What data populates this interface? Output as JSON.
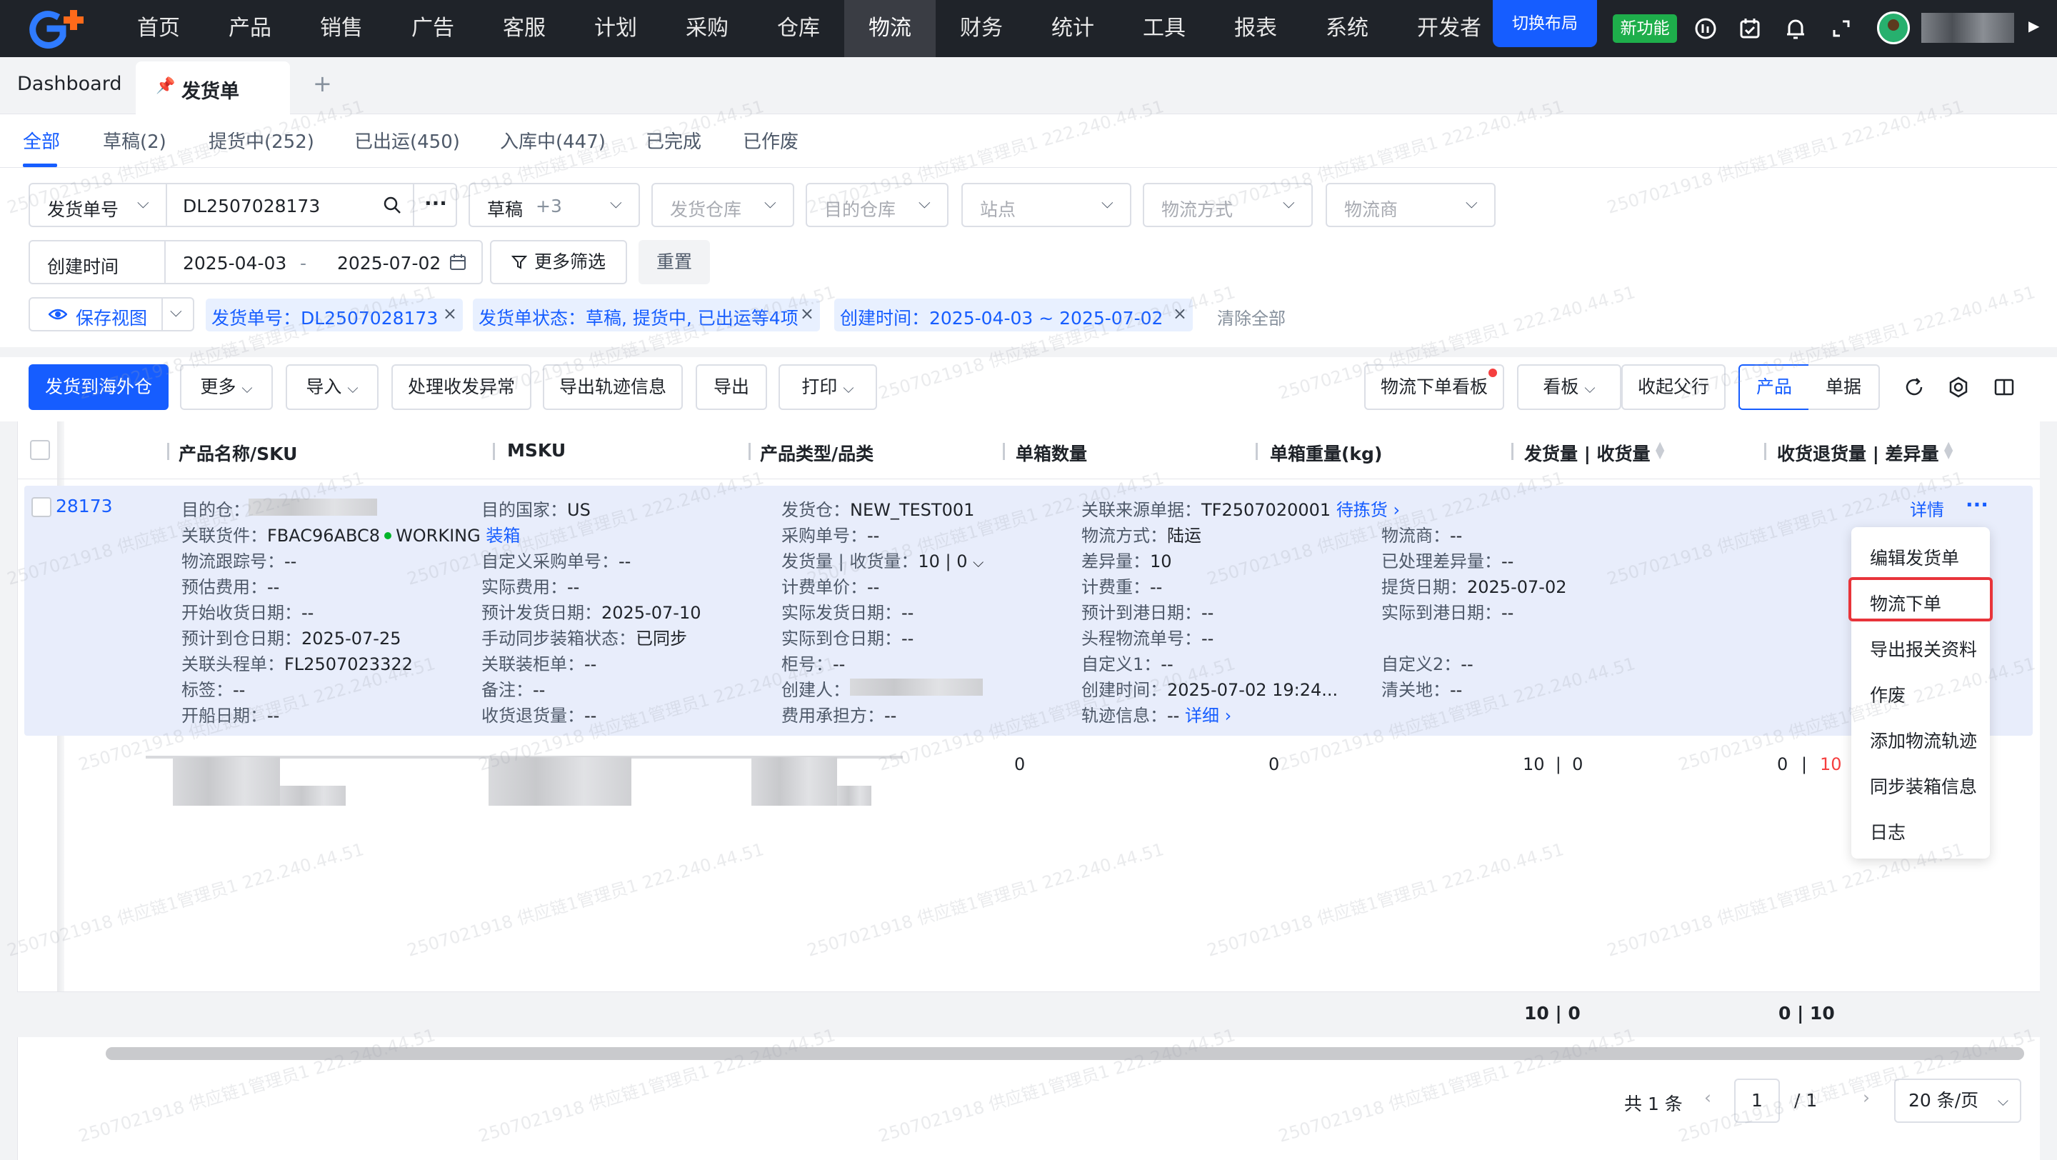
{
  "nav": {
    "items": [
      "首页",
      "产品",
      "销售",
      "广告",
      "客服",
      "计划",
      "采购",
      "仓库",
      "物流",
      "财务",
      "统计",
      "工具",
      "报表",
      "系统",
      "开发者"
    ],
    "active_index": 8,
    "switch_layout": "切换布局",
    "new_feature": "新功能"
  },
  "tabs": {
    "dashboard": "Dashboard",
    "active": "发货单",
    "add": "+"
  },
  "status_tabs": [
    "全部",
    "草稿(2)",
    "提货中(252)",
    "已出运(450)",
    "入库中(447)",
    "已完成",
    "已作废"
  ],
  "filters": {
    "search_type": "发货单号",
    "search_value": "DL2507028173",
    "more_dots": "···",
    "status_value": "草稿",
    "status_extra": "+3",
    "ship_warehouse": "发货仓库",
    "dest_warehouse": "目的仓库",
    "site": "站点",
    "logistics_method": "物流方式",
    "carrier": "物流商",
    "date_type": "创建时间",
    "date_start": "2025-04-03",
    "date_dash": "-",
    "date_end": "2025-07-02",
    "more_filter": "更多筛选",
    "reset": "重置",
    "save_view": "保存视图",
    "chips": [
      "发货单号：DL2507028173",
      "发货单状态：草稿, 提货中, 已出运等4项",
      "创建时间：2025-04-03 ~ 2025-07-02"
    ],
    "clear_all": "清除全部"
  },
  "toolbar": {
    "ship_overseas": "发货到海外仓",
    "more": "更多",
    "import": "导入",
    "handle_exception": "处理收发异常",
    "export_track": "导出轨迹信息",
    "export": "导出",
    "print": "打印",
    "logistics_board": "物流下单看板",
    "board": "看板",
    "collapse_parent": "收起父行",
    "view_product": "产品",
    "view_doc": "单据"
  },
  "table": {
    "headers": [
      "产品名称/SKU",
      "MSKU",
      "产品类型/品类",
      "单箱数量",
      "单箱重量(kg)",
      "发货量 | 收货量",
      "收货退货量 | 差异量"
    ],
    "row": {
      "id": "28173",
      "col1": [
        {
          "label": "目的仓：",
          "value": ""
        },
        {
          "label": "关联货件：",
          "value": "FBAC96ABC8"
        },
        {
          "label": "物流跟踪号：",
          "value": "--"
        },
        {
          "label": "预估费用：",
          "value": "--"
        },
        {
          "label": "开始收货日期：",
          "value": "--"
        },
        {
          "label": "预计到仓日期：",
          "value": "2025-07-25"
        },
        {
          "label": "关联头程单：",
          "value": "FL2507023322"
        },
        {
          "label": "标签：",
          "value": "--"
        },
        {
          "label": "开船日期：",
          "value": "--"
        }
      ],
      "working": "WORKING",
      "boxing": "装箱",
      "col2": [
        {
          "label": "目的国家：",
          "value": "US"
        },
        {
          "label": "",
          "value": ""
        },
        {
          "label": "自定义采购单号：",
          "value": "--"
        },
        {
          "label": "实际费用：",
          "value": "--"
        },
        {
          "label": "预计发货日期：",
          "value": "2025-07-10"
        },
        {
          "label": "手动同步装箱状态：",
          "value": "已同步"
        },
        {
          "label": "关联装柜单：",
          "value": "--"
        },
        {
          "label": "备注：",
          "value": "--"
        },
        {
          "label": "收货退货量：",
          "value": "--"
        }
      ],
      "col3": [
        {
          "label": "发货仓：",
          "value": "NEW_TEST001"
        },
        {
          "label": "采购单号：",
          "value": "--"
        },
        {
          "label": "发货量 | 收货量：",
          "value": "10 | 0"
        },
        {
          "label": "计费单价：",
          "value": "--"
        },
        {
          "label": "实际发货日期：",
          "value": "--"
        },
        {
          "label": "实际到仓日期：",
          "value": "--"
        },
        {
          "label": "柜号：",
          "value": "--"
        },
        {
          "label": "创建人：",
          "value": ""
        },
        {
          "label": "费用承担方：",
          "value": "--"
        }
      ],
      "col4": [
        {
          "label": "关联来源单据：",
          "value": "TF2507020001"
        },
        {
          "label": "物流方式：",
          "value": "陆运"
        },
        {
          "label": "差异量：",
          "value": "10"
        },
        {
          "label": "计费重：",
          "value": "--"
        },
        {
          "label": "预计到港日期：",
          "value": "--"
        },
        {
          "label": "头程物流单号：",
          "value": "--"
        },
        {
          "label": "自定义1：",
          "value": "--"
        },
        {
          "label": "创建时间：",
          "value": "2025-07-02 19:24..."
        },
        {
          "label": "轨迹信息：",
          "value": "--"
        }
      ],
      "pending_pick": "待拣货",
      "track_detail": "详细",
      "col5": [
        {
          "label": "物流商：",
          "value": "--"
        },
        {
          "label": "已处理差异量：",
          "value": "--"
        },
        {
          "label": "提货日期：",
          "value": "2025-07-02"
        },
        {
          "label": "实际到港日期：",
          "value": "--"
        },
        {
          "label": "",
          "value": ""
        },
        {
          "label": "",
          "value": ""
        },
        {
          "label": "自定义2：",
          "value": "--"
        },
        {
          "label": "清关地：",
          "value": "--"
        },
        {
          "label": "",
          "value": ""
        }
      ],
      "detail": "详情",
      "more": "···"
    },
    "sub_row": {
      "box_qty": "0",
      "box_weight": "0",
      "ship_recv": "10  |  0",
      "return_zero": "0",
      "pipe": "|",
      "return_diff": "10"
    },
    "summary": {
      "ship_recv": "10 | 0",
      "return_diff": "0 | 10"
    }
  },
  "dropdown": {
    "items": [
      "编辑发货单",
      "物流下单",
      "导出报关资料",
      "作废",
      "添加物流轨迹",
      "同步装箱信息",
      "日志"
    ],
    "highlighted_index": 1
  },
  "pagination": {
    "total": "共 1 条",
    "prev": "‹",
    "page": "1",
    "separator": "/  1",
    "next": "›",
    "page_size": "20 条/页"
  },
  "watermark": "2507021918 供应链1管理员1 222.240.44.51",
  "colors": {
    "primary": "#165dff",
    "nav_bg": "#1f2329",
    "new_feature": "#1eae4b",
    "danger": "#f53f3f"
  }
}
